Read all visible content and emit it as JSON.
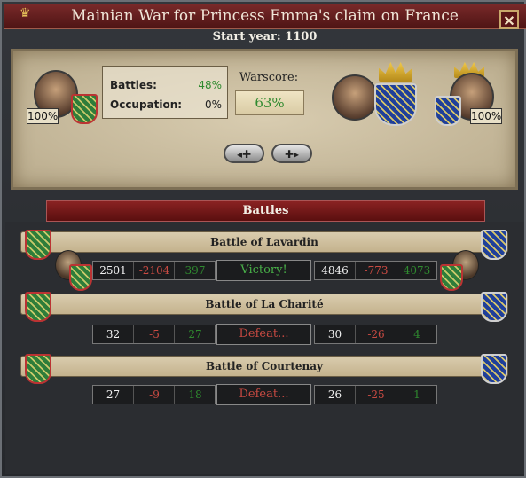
{
  "window": {
    "title": "Mainian War for Princess Emma's claim on France",
    "close_label": "✕",
    "start_year": "Start year: 1100"
  },
  "summary": {
    "attacker_percent": "100%",
    "defender_percent": "100%",
    "battles_label": "Battles:",
    "battles_value": "48%",
    "occupation_label": "Occupation:",
    "occupation_value": "0%",
    "warscore_label": "Warscore:",
    "warscore_value": "63%",
    "nav_prev": "◂✚",
    "nav_next": "✚▸"
  },
  "battles_header": "Battles",
  "battles": [
    {
      "name": "Battle of Lavardin",
      "left": {
        "troops": "2501",
        "losses": "-2104",
        "survivors": "397"
      },
      "result": "Victory!",
      "right": {
        "troops": "4846",
        "losses": "-773",
        "survivors": "4073"
      },
      "outcome": "win"
    },
    {
      "name": "Battle of La Charité",
      "left": {
        "troops": "32",
        "losses": "-5",
        "survivors": "27"
      },
      "result": "Defeat...",
      "right": {
        "troops": "30",
        "losses": "-26",
        "survivors": "4"
      },
      "outcome": "lose"
    },
    {
      "name": "Battle of Courtenay",
      "left": {
        "troops": "27",
        "losses": "-9",
        "survivors": "18"
      },
      "result": "Defeat...",
      "right": {
        "troops": "26",
        "losses": "-25",
        "survivors": "1"
      },
      "outcome": "lose"
    }
  ],
  "colors": {
    "green": "#2f8a2f",
    "red": "#c84a42",
    "title_red": "#6e1e1e"
  }
}
